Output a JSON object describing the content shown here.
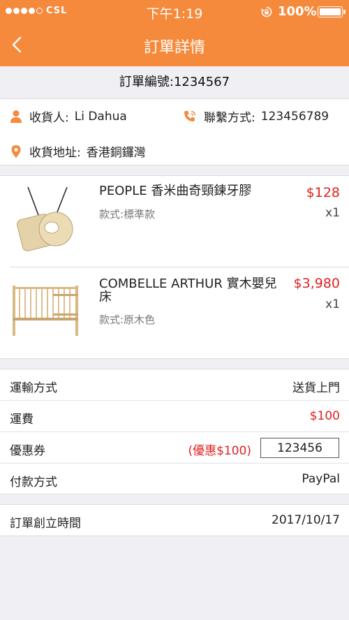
{
  "status_bar": {
    "carrier": "CSL",
    "time": "下午1:19",
    "battery_percent": "100%",
    "signal_bars": 4
  },
  "nav": {
    "title": "訂單詳情",
    "back_icon": "chevron-left-icon"
  },
  "order": {
    "number_label": "訂單編號:",
    "number": "1234567"
  },
  "customer": {
    "name_label": "收貨人:",
    "name": "Li Dahua",
    "contact_label": "聯繫方式:",
    "contact": "123456789",
    "address_label": "收貨地址:",
    "address": "香港銅鑼灣"
  },
  "items": [
    {
      "name": "PEOPLE 香米曲奇頸鍊牙膠",
      "variant": "款式:標準款",
      "price": "$128",
      "qty": "x1"
    },
    {
      "name": "COMBELLE ARTHUR 實木嬰兒床",
      "variant": "款式:原木色",
      "price": "$3,980",
      "qty": "x1"
    }
  ],
  "shipping": {
    "method_label": "運輸方式",
    "method": "送貨上門",
    "fee_label": "運費",
    "fee": "$100"
  },
  "coupon": {
    "label": "優惠券",
    "discount": "(優惠$100)",
    "code": "123456"
  },
  "payment": {
    "label": "付款方式",
    "method": "PayPal"
  },
  "created": {
    "label": "訂單創立時間",
    "date": "2017/10/17"
  },
  "colors": {
    "brand": "#f58a3c",
    "price": "#e02222",
    "background": "#efeff4"
  }
}
